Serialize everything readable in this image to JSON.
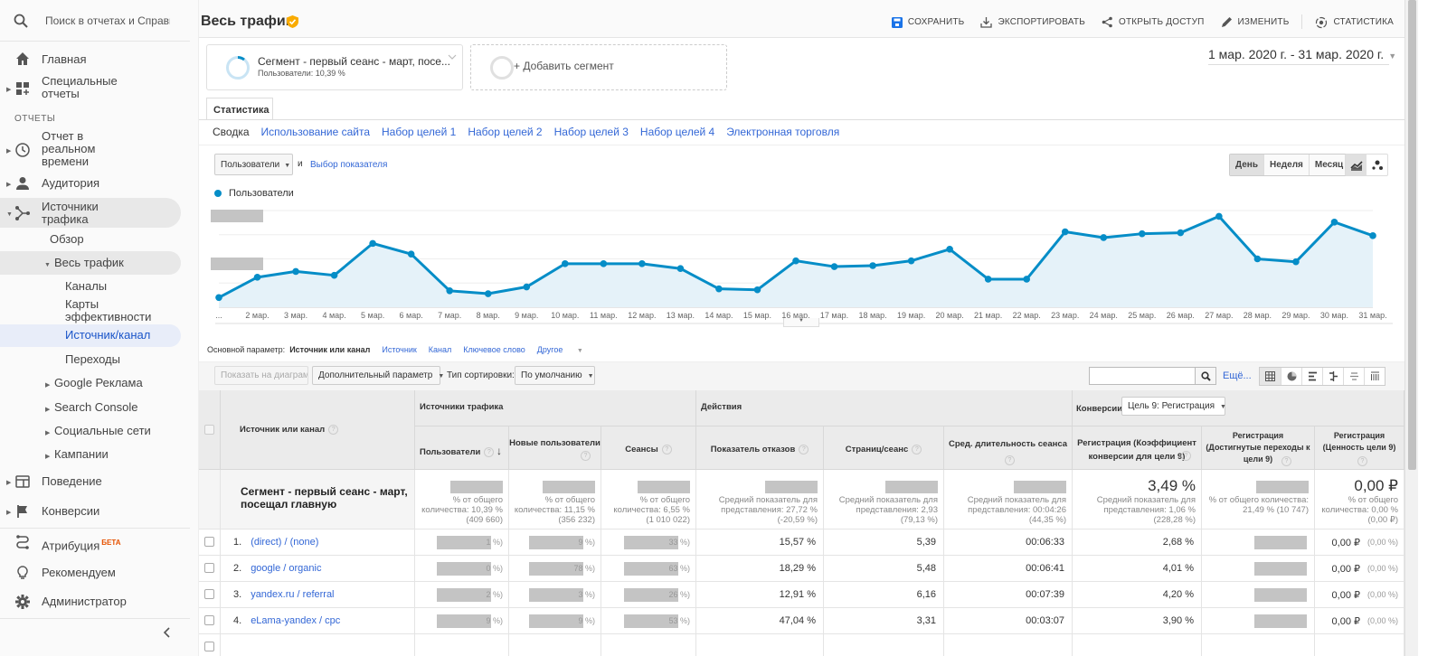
{
  "sidebar": {
    "search_placeholder": "Поиск в отчетах и Справке",
    "items": [
      {
        "label": "Главная",
        "icon": "home-icon"
      },
      {
        "label": "Специальные отчеты",
        "icon": "custom-reports-icon"
      }
    ],
    "section_reports": "ОТЧЕТЫ",
    "reports": [
      {
        "label": "Отчет в реальном времени",
        "icon": "clock-icon"
      },
      {
        "label": "Аудитория",
        "icon": "person-icon"
      },
      {
        "label": "Источники трафика",
        "icon": "acquisition-icon"
      }
    ],
    "acquisition_children": {
      "overview": "Обзор",
      "all_traffic": "Весь трафик",
      "all_traffic_children": [
        "Каналы",
        "Карты эффективности",
        "Источник/канал",
        "Переходы"
      ],
      "groups": [
        "Google Реклама",
        "Search Console",
        "Социальные сети",
        "Кампании"
      ]
    },
    "more": [
      {
        "label": "Поведение",
        "icon": "behavior-icon"
      },
      {
        "label": "Конверсии",
        "icon": "flag-icon"
      }
    ],
    "bottom": [
      {
        "label": "Атрибуция",
        "badge": "БЕТА",
        "icon": "attribution-icon"
      },
      {
        "label": "Рекомендуем",
        "icon": "lightbulb-icon"
      },
      {
        "label": "Администратор",
        "icon": "gear-icon"
      }
    ],
    "collapse_icon": "chevron-left-icon"
  },
  "header": {
    "title": "Весь трафик",
    "actions": {
      "save": "СОХРАНИТЬ",
      "export": "ЭКСПОРТИРОВАТЬ",
      "share": "ОТКРЫТЬ ДОСТУП",
      "edit": "ИЗМЕНИТЬ",
      "insights": "СТАТИСТИКА"
    }
  },
  "segments": {
    "active_title": "Сегмент - первый сеанс - март, посе...",
    "active_sub": "Пользователи: 10,39 %",
    "add_label": "+ Добавить сегмент"
  },
  "date_range": "1 мар. 2020 г. - 31 мар. 2020 г.",
  "tabs": {
    "main": "Статистика",
    "sub": [
      "Сводка",
      "Использование сайта",
      "Набор целей 1",
      "Набор целей 2",
      "Набор целей 3",
      "Набор целей 4",
      "Электронная торговля"
    ]
  },
  "chart_controls": {
    "metric": "Пользователи",
    "and": "и",
    "select_metric": "Выбор показателя",
    "periods": [
      "День",
      "Неделя",
      "Месяц"
    ],
    "active_period": "День"
  },
  "chart_data": {
    "type": "line",
    "title": "",
    "legend": [
      "Пользователи"
    ],
    "legend_position": "top-left",
    "series": [
      {
        "name": "Пользователи",
        "color": "#058dc7",
        "values": [
          10,
          31,
          37,
          33,
          66,
          55,
          17,
          14,
          21,
          45,
          45,
          45,
          40,
          19,
          18,
          48,
          42,
          43,
          48,
          60,
          29,
          29,
          78,
          72,
          76,
          77,
          94,
          50,
          47,
          88,
          74
        ]
      }
    ],
    "x": [
      "...",
      "2 мар.",
      "3 мар.",
      "4 мар.",
      "5 мар.",
      "6 мар.",
      "7 мар.",
      "8 мар.",
      "9 мар.",
      "10 мар.",
      "11 мар.",
      "12 мар.",
      "13 мар.",
      "14 мар.",
      "15 мар.",
      "16 мар.",
      "17 мар.",
      "18 мар.",
      "19 мар.",
      "20 мар.",
      "21 мар.",
      "22 мар.",
      "23 мар.",
      "24 мар.",
      "25 мар.",
      "26 мар.",
      "27 мар.",
      "28 мар.",
      "29 мар.",
      "30 мар.",
      "31 мар."
    ],
    "ylim": [
      0,
      100
    ],
    "y_note": "y-axis tick labels are redacted; values are relative (0-100 scale)",
    "grid": true,
    "xlabel": "",
    "ylabel": ""
  },
  "dimensions": {
    "label": "Основной параметр:",
    "active": "Источник или канал",
    "options": [
      "Источник",
      "Канал",
      "Ключевое слово",
      "Другое"
    ]
  },
  "table_toolbar": {
    "plot_rows": "Показать на диаграмме",
    "secondary_dim": "Дополнительный параметр",
    "sort_label": "Тип сортировки:",
    "sort_value": "По умолчанию",
    "search_value": "",
    "more": "Ещё..."
  },
  "table": {
    "col_dim": "Источник или канал",
    "groups": {
      "acquisition": "Источники трафика",
      "behavior": "Действия",
      "conversions": "Конверсии",
      "goal_select": "Цель 9: Регистрация"
    },
    "columns": [
      "Пользователи",
      "Новые пользователи",
      "Сеансы",
      "Показатель отказов",
      "Страниц/сеанс",
      "Сред. длительность сеанса",
      "Регистрация (Коэффициент конверсии для цели 9)",
      "Регистрация (Достигнутые переходы к цели 9)",
      "Регистрация (Ценность цели 9)"
    ],
    "summary": {
      "label": "Сегмент - первый сеанс - март, посещал главную",
      "users_sub": "% от общего количества: 10,39 % (409 660)",
      "new_users_sub": "% от общего количества: 11,15 % (356 232)",
      "sessions_sub": "% от общего количества: 6,55 % (1 010 022)",
      "bounce_sub": "Средний показатель для представления: 27,72 % (-20,59 %)",
      "pages_sub": "Средний показатель для представления: 2,93 (79,13 %)",
      "duration_sub": "Средний показатель для представления: 00:04:26 (44,35 %)",
      "conv_rate": "3,49 %",
      "conv_rate_sub": "Средний показатель для представления: 1,06 % (228,28 %)",
      "completions_sub": "% от общего количества: 21,49 % (10 747)",
      "value": "0,00 ₽",
      "value_sub": "% от общего количества: 0,00 % (0,00 ₽)"
    },
    "rows": [
      {
        "n": "1.",
        "source": "(direct) / (none)",
        "users_tail": "1 %)",
        "new_tail": "9 %)",
        "sess_tail": "33 %)",
        "bounce": "15,57 %",
        "pages": "5,39",
        "duration": "00:06:33",
        "conv": "2,68 %",
        "value": "0,00 ₽",
        "value_pct": "(0,00 %)"
      },
      {
        "n": "2.",
        "source": "google / organic",
        "users_tail": "0 %)",
        "new_tail": "78 %)",
        "sess_tail": "63 %)",
        "bounce": "18,29 %",
        "pages": "5,48",
        "duration": "00:06:41",
        "conv": "4,01 %",
        "value": "0,00 ₽",
        "value_pct": "(0,00 %)"
      },
      {
        "n": "3.",
        "source": "yandex.ru / referral",
        "users_tail": "2 %)",
        "new_tail": "3 %)",
        "sess_tail": "26 %)",
        "bounce": "12,91 %",
        "pages": "6,16",
        "duration": "00:07:39",
        "conv": "4,20 %",
        "value": "0,00 ₽",
        "value_pct": "(0,00 %)"
      },
      {
        "n": "4.",
        "source": "eLama-yandex / cpc",
        "users_tail": "9 %)",
        "new_tail": "9 %)",
        "sess_tail": "53 %)",
        "bounce": "47,04 %",
        "pages": "3,31",
        "duration": "00:03:07",
        "conv": "3,90 %",
        "value": "0,00 ₽",
        "value_pct": "(0,00 %)"
      }
    ]
  }
}
